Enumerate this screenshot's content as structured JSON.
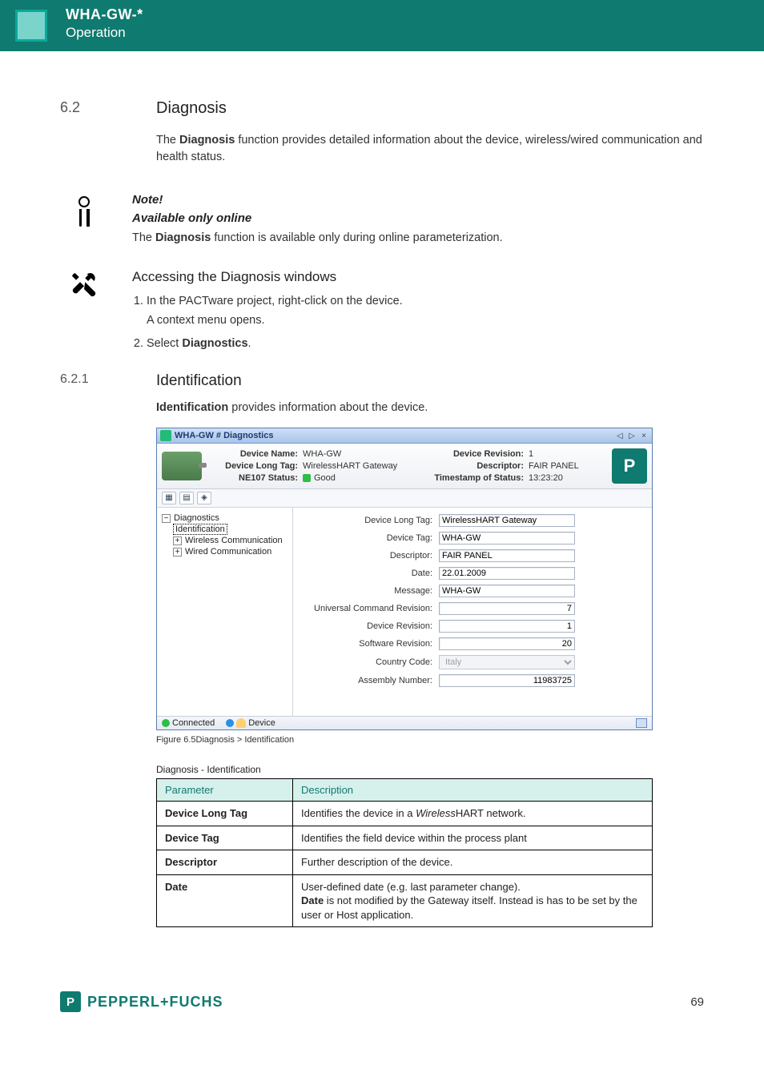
{
  "banner": {
    "title": "WHA-GW-*",
    "subtitle": "Operation"
  },
  "sec62": {
    "num": "6.2",
    "title": "Diagnosis",
    "para": "The {b}Diagnosis{/b} function provides detailed information about the device, wireless/wired communication and health status."
  },
  "note": {
    "heading": "Note!",
    "sub": "Available only online",
    "para": "The {b}Diagnosis{/b} function is available only during online parameterization."
  },
  "accessing": {
    "title": "Accessing the Diagnosis windows",
    "steps": [
      {
        "text": "In the PACTware project, right-click on the device.",
        "sub": "A context menu opens."
      },
      {
        "text": "Select {b}Diagnostics{/b}."
      }
    ]
  },
  "sec621": {
    "num": "6.2.1",
    "title": "Identification",
    "para": "{b}Identification{/b} provides information about the device."
  },
  "shot": {
    "title": "WHA-GW # Diagnostics",
    "ctrls": [
      "◁",
      "▷",
      "×"
    ],
    "header": {
      "labels": {
        "device_name": "Device Name:",
        "device_long_tag": "Device Long Tag:",
        "ne107": "NE107 Status:",
        "device_rev": "Device Revision:",
        "descriptor": "Descriptor:",
        "ts": "Timestamp of Status:"
      },
      "values": {
        "device_name": "WHA-GW",
        "device_long_tag": "WirelessHART Gateway",
        "ne107": "Good",
        "device_rev": "1",
        "descriptor": "FAIR PANEL",
        "ts": "13:23:20"
      }
    },
    "toolbar_icons": [
      "▦",
      "▤",
      "◈"
    ],
    "tree": {
      "root": "Diagnostics",
      "selected": "Identification",
      "children": [
        "Wireless Communication",
        "Wired Communication"
      ]
    },
    "form_rows": [
      {
        "label": "Device Long Tag:",
        "value": "WirelessHART Gateway",
        "type": "text"
      },
      {
        "label": "Device Tag:",
        "value": "WHA-GW",
        "type": "text"
      },
      {
        "label": "Descriptor:",
        "value": "FAIR PANEL",
        "type": "text"
      },
      {
        "label": "Date:",
        "value": "22.01.2009",
        "type": "text"
      },
      {
        "label": "Message:",
        "value": "WHA-GW",
        "type": "text"
      },
      {
        "label": "Universal Command Revision:",
        "value": "7",
        "type": "ro"
      },
      {
        "label": "Device Revision:",
        "value": "1",
        "type": "ro"
      },
      {
        "label": "Software Revision:",
        "value": "20",
        "type": "ro"
      },
      {
        "label": "Country Code:",
        "value": "Italy",
        "type": "select_disabled"
      },
      {
        "label": "Assembly Number:",
        "value": "11983725",
        "type": "ro"
      }
    ],
    "status": {
      "conn": "Connected",
      "dev": "Device"
    }
  },
  "figure_caption": "Figure 6.5Diagnosis > Identification",
  "table": {
    "caption": "Diagnosis - Identification",
    "headers": [
      "Parameter",
      "Description"
    ],
    "rows": [
      {
        "param": "Device Long Tag",
        "desc": "Identifies the device in a {i}Wireless{/i}HART network."
      },
      {
        "param": "Device Tag",
        "desc": "Identifies the field device within the process plant"
      },
      {
        "param": "Descriptor",
        "desc": "Further description of the device."
      },
      {
        "param": "Date",
        "desc": "User-defined date (e.g. last parameter change).\n{b}Date{/b} is not modified by the Gateway itself. Instead is has to be set by the user or Host application."
      }
    ]
  },
  "footer": {
    "brand": "PEPPERL+FUCHS",
    "badge": "P",
    "page": "69"
  }
}
